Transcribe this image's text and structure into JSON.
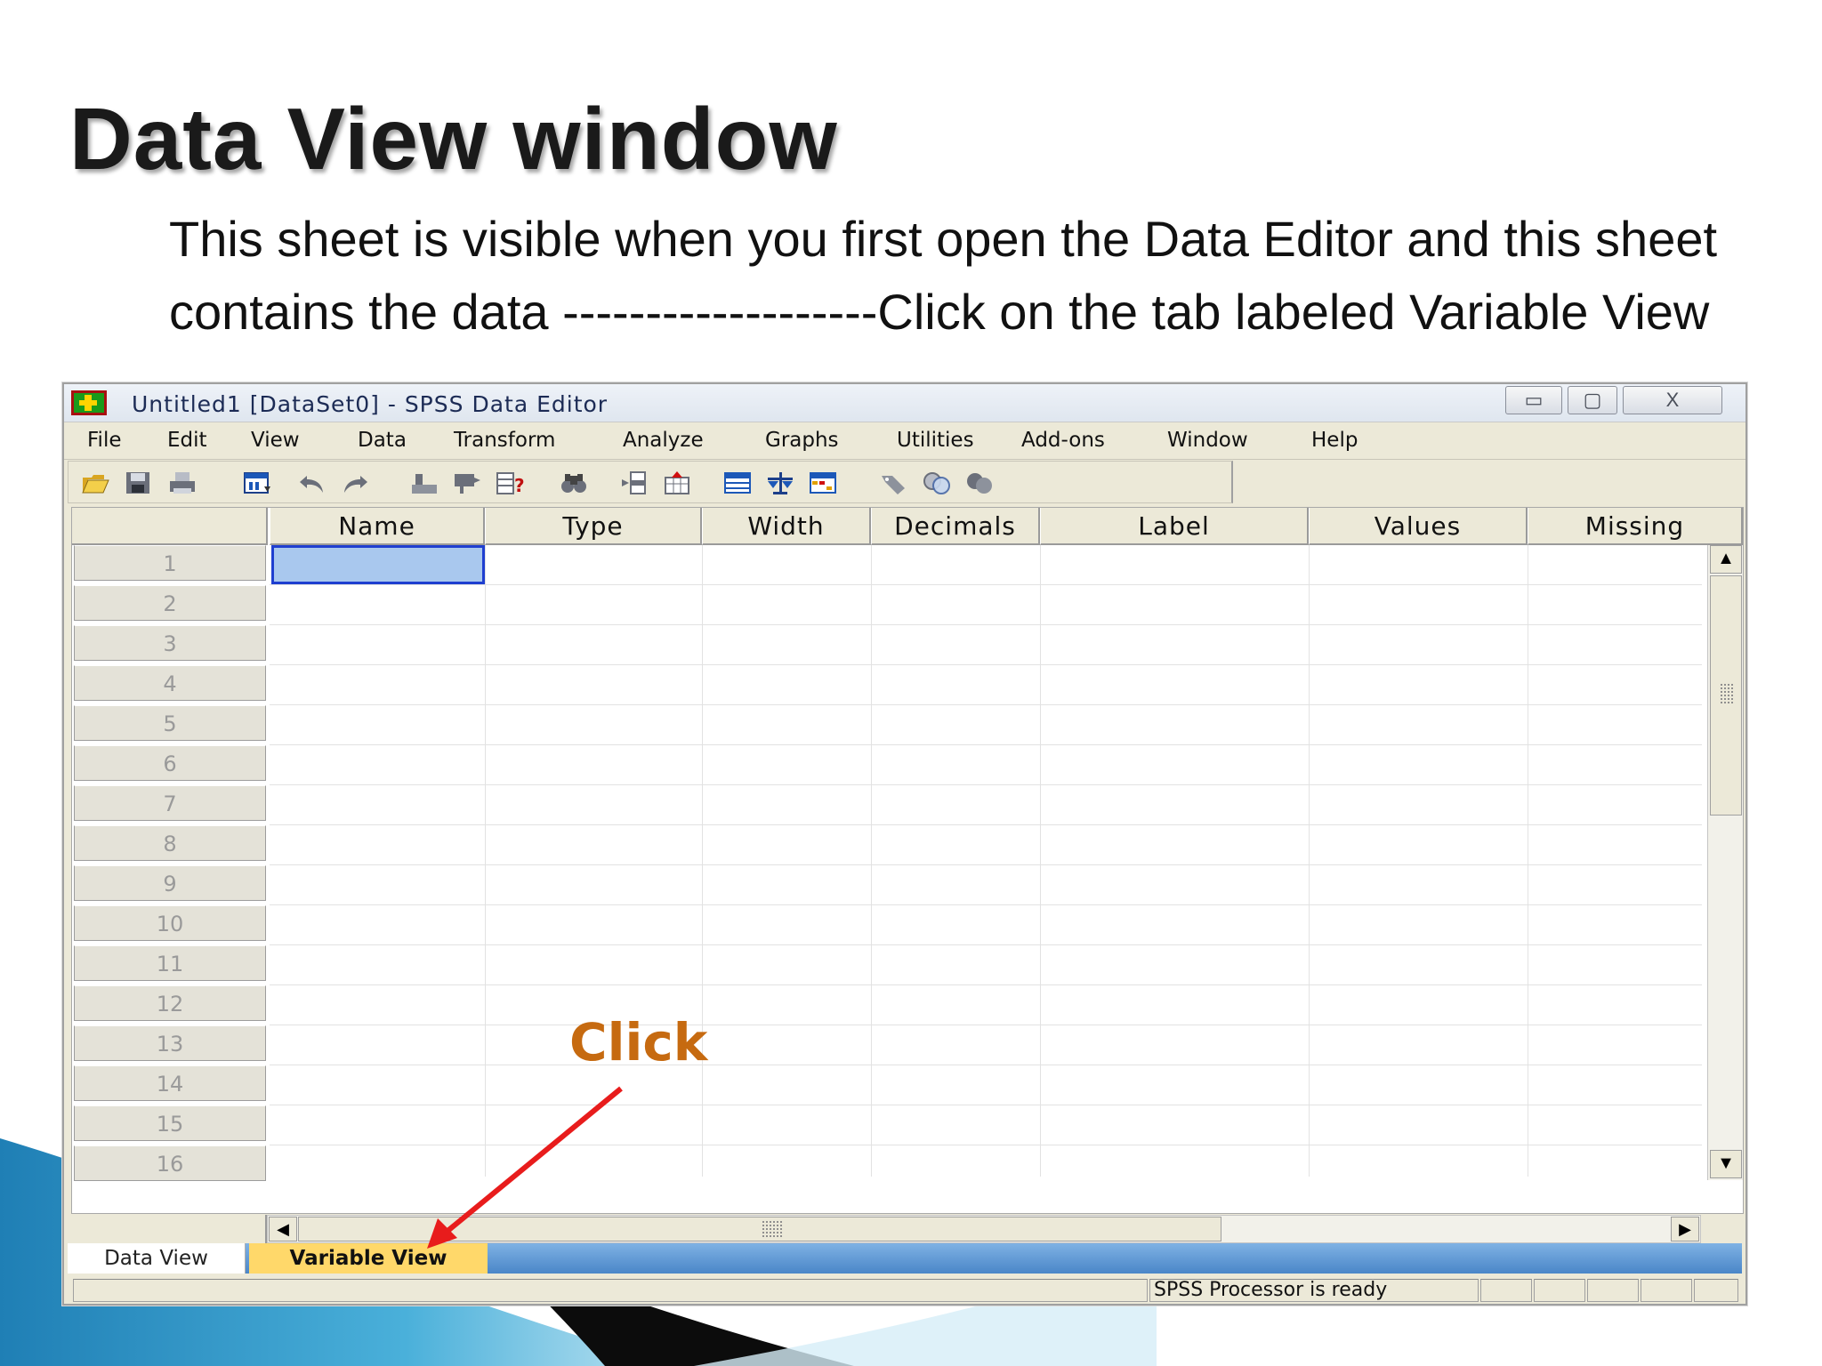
{
  "slide": {
    "title": "Data View window",
    "body_line1": "This sheet is visible when you first open the Data Editor and this sheet",
    "body_line2": "contains the data -------------------Click on the tab labeled Variable View"
  },
  "window": {
    "title": "Untitled1 [DataSet0] - SPSS Data Editor",
    "controls": {
      "minimize": "▭",
      "maximize": "▢",
      "close": "X"
    }
  },
  "menu": [
    "File",
    "Edit",
    "View",
    "Data",
    "Transform",
    "Analyze",
    "Graphs",
    "Utilities",
    "Add-ons",
    "Window",
    "Help"
  ],
  "toolbar_icons": [
    "open-icon",
    "save-icon",
    "print-icon",
    "dialog-recall-icon",
    "undo-icon",
    "redo-icon",
    "goto-case-icon",
    "goto-variable-icon",
    "variables-icon",
    "find-icon",
    "insert-cases-icon",
    "insert-variable-icon",
    "split-file-icon",
    "weight-cases-icon",
    "select-cases-icon",
    "value-labels-icon",
    "use-sets-icon",
    "show-all-variables-icon"
  ],
  "grid": {
    "columns": [
      "Name",
      "Type",
      "Width",
      "Decimals",
      "Label",
      "Values",
      "Missing"
    ],
    "rows": [
      "1",
      "2",
      "3",
      "4",
      "5",
      "6",
      "7",
      "8",
      "9",
      "10",
      "11",
      "12",
      "13",
      "14",
      "15",
      "16"
    ]
  },
  "tabs": {
    "data_view": "Data View",
    "variable_view": "Variable View"
  },
  "status": {
    "processor": "SPSS  Processor is ready"
  },
  "annotation": {
    "click_label": "Click"
  },
  "colors": {
    "click_label": "#c66a10",
    "arrow": "#e81c1c",
    "active_tab": "#ffd86a",
    "selected_cell": "#a9c8ee"
  }
}
